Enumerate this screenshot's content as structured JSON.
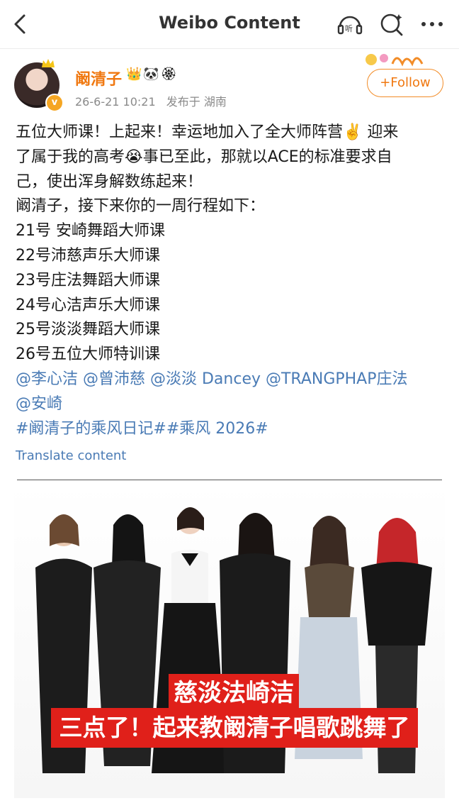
{
  "topbar": {
    "title": "Weibo Content"
  },
  "post": {
    "author": "阚清子",
    "badges": "👑🐼🏵",
    "verified_mark": "v",
    "time": "26-6-21 10:21",
    "source": "发布于 湖南",
    "follow_label": "+Follow",
    "lines": [
      "五位大师课！上起来！幸运地加入了全大师阵营✌️ 迎来",
      "了属于我的高考😭事已至此，那就以ACE的标准要求自",
      "己，使出浑身解数练起来！",
      "阚清子，接下来你的一周行程如下：",
      "21号 安崎舞蹈大师课",
      "22号沛慈声乐大师课",
      "23号庄法舞蹈大师课",
      "24号心洁声乐大师课",
      "25号淡淡舞蹈大师课",
      "26号五位大师特训课"
    ],
    "mentions_line1": "@李心洁 @曾沛慈 @淡淡 Dancey @TRANGPHAP庄法",
    "mentions_line2": "@安崎",
    "hashtags": "#阚清子的乘风日记##乘风 2026#",
    "translate_label": "Translate content"
  },
  "image": {
    "banner_names": "慈淡法崎洁",
    "banner_caption": "三点了！起来教阚清子唱歌跳舞了"
  },
  "colors": {
    "accent": "#f07810",
    "link": "#4a7bb5",
    "banner": "#e0201a"
  }
}
